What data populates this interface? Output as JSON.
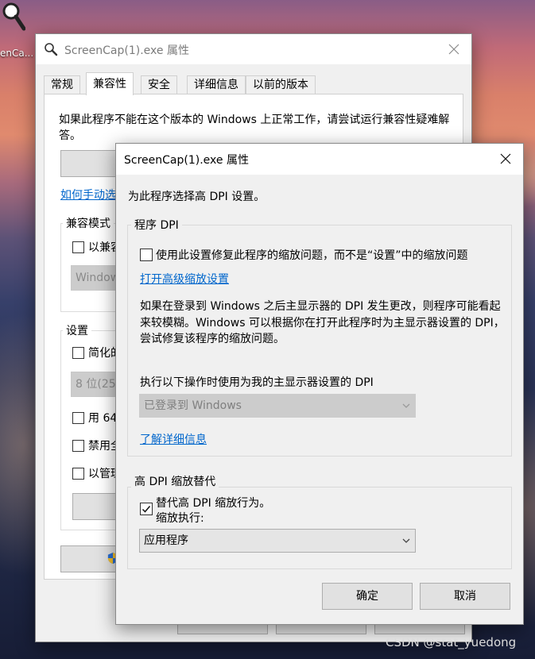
{
  "desktop": {
    "icon_label": "enCa...",
    "watermark": "CSDN @stat_yuedong"
  },
  "back_window": {
    "title": "ScreenCap(1).exe 属性",
    "tabs": [
      {
        "label": "常规"
      },
      {
        "label": "兼容性",
        "active": true
      },
      {
        "label": "安全"
      },
      {
        "label": "详细信息"
      },
      {
        "label": "以前的版本"
      }
    ],
    "intro": "如果此程序不能在这个版本的 Windows 上正常工作，请尝试运行兼容性疑难解答。",
    "link": "如何手动选",
    "compat_mode_label": "兼容模式",
    "compat_checkbox": "以兼容",
    "compat_combo": "Window",
    "settings_label": "设置",
    "settings_items": [
      "简化的",
      "用 64",
      "禁用全",
      "以管理"
    ],
    "color_combo": "8 位(25"
  },
  "dialog": {
    "title": "ScreenCap(1).exe 属性",
    "intro": "为此程序选择高 DPI 设置。",
    "program_dpi": {
      "group_label": "程序 DPI",
      "checkbox_label": "使用此设置修复此程序的缩放问题，而不是“设置”中的缩放问题",
      "checked": false,
      "advanced_link": "打开高级缩放设置",
      "paragraph": "如果在登录到 Windows 之后主显示器的 DPI 发生更改，则程序可能看起来较模糊。Windows 可以根据你在打开此程序时为主显示器设置的 DPI，尝试修复该程序的缩放问题。",
      "when_label": "执行以下操作时使用为我的主显示器设置的 DPI",
      "when_value": "已登录到 Windows",
      "learn_more_link": "了解详细信息"
    },
    "override": {
      "group_label": "高 DPI 缩放替代",
      "checkbox_label": "替代高 DPI 缩放行为。",
      "checked": true,
      "scaling_label": "缩放执行:",
      "scaling_value": "应用程序"
    },
    "ok_label": "确定",
    "cancel_label": "取消"
  }
}
